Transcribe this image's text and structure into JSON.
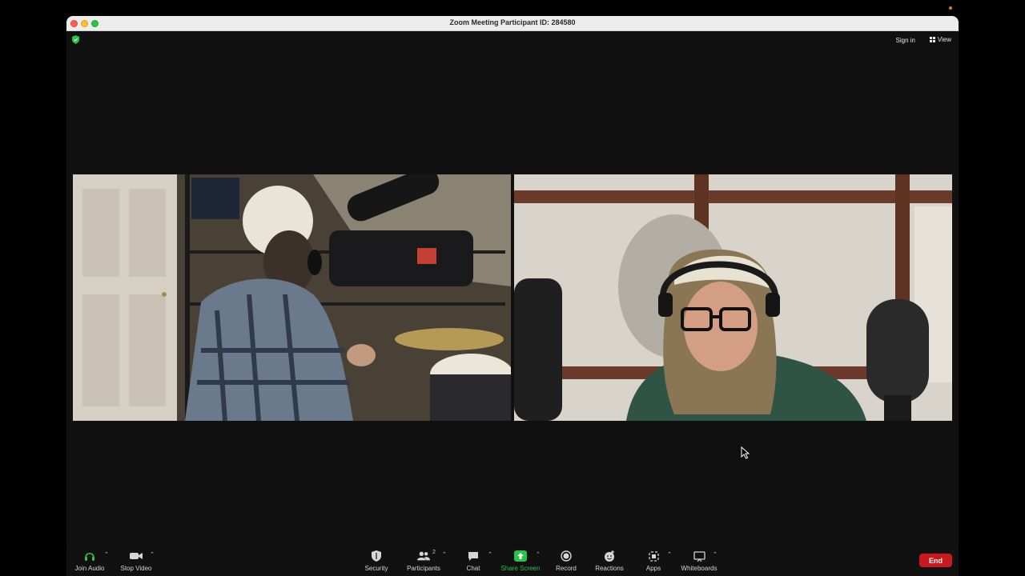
{
  "window": {
    "title": "Zoom Meeting Participant ID: 284580"
  },
  "topbar": {
    "sign_in": "Sign in",
    "view_label": "View"
  },
  "toolbar": {
    "join_audio": "Join Audio",
    "stop_video": "Stop Video",
    "security": "Security",
    "participants": "Participants",
    "participants_count": "2",
    "chat": "Chat",
    "share_screen": "Share Screen",
    "record": "Record",
    "reactions": "Reactions",
    "apps": "Apps",
    "whiteboards": "Whiteboards",
    "end": "End"
  },
  "colors": {
    "accent_green": "#27c44b",
    "end_red": "#c8191f",
    "meeting_bg": "#101010"
  },
  "icons": [
    "shield-check-icon",
    "grid-view-icon",
    "headphones-icon",
    "video-camera-icon",
    "security-shield-icon",
    "participants-icon",
    "chat-bubble-icon",
    "share-screen-arrow-icon",
    "record-icon",
    "reactions-smiley-icon",
    "apps-icon",
    "whiteboard-icon",
    "caret-up-icon",
    "mouse-cursor-icon"
  ]
}
